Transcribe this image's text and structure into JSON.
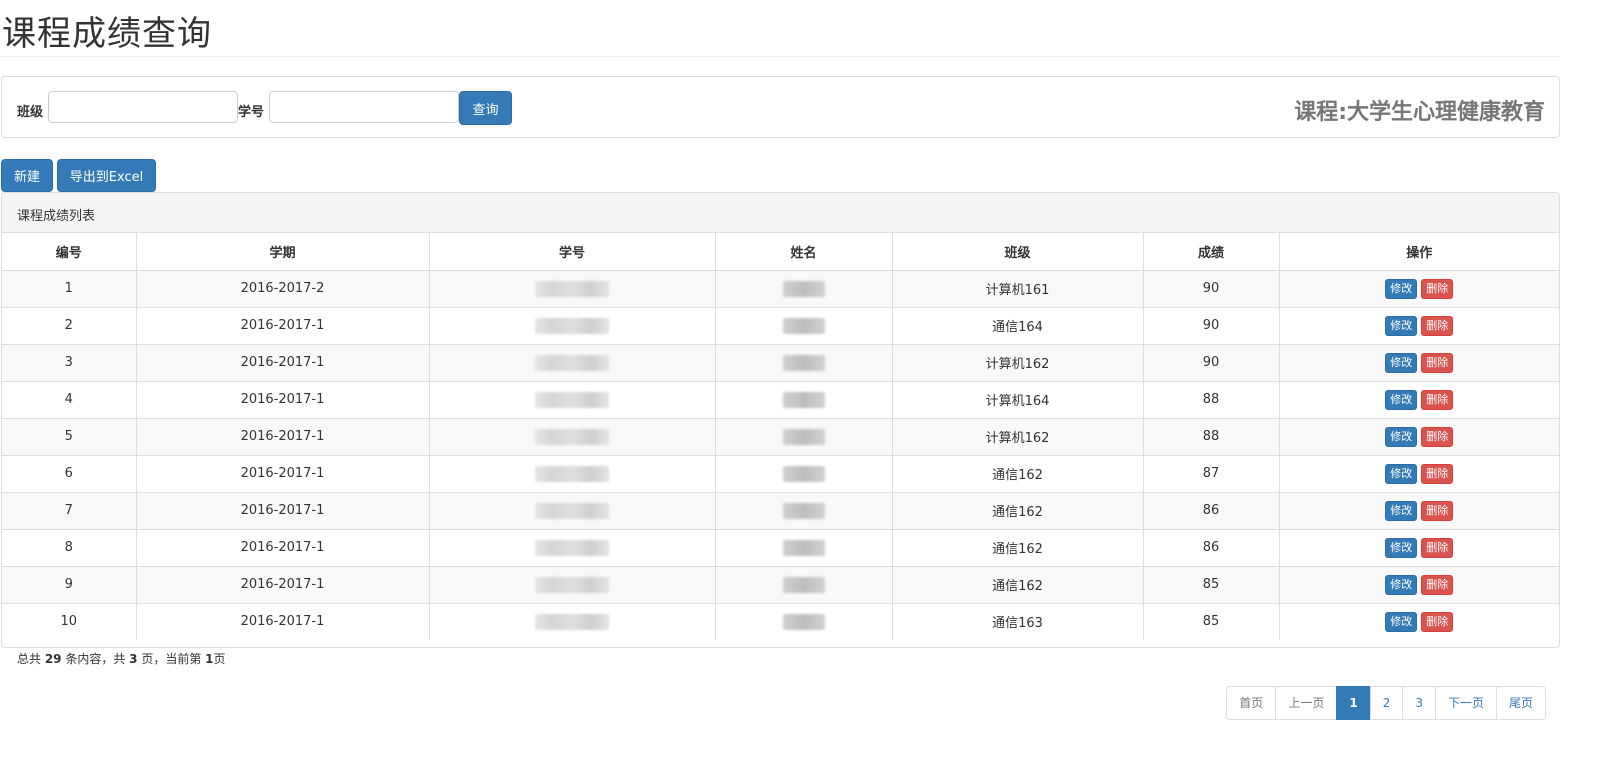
{
  "page": {
    "title": "课程成绩查询"
  },
  "search": {
    "class_label": "班级",
    "class_value": "",
    "student_id_label": "学号",
    "student_id_value": "",
    "submit_label": "查询",
    "course_label": "课程:大学生心理健康教育"
  },
  "toolbar": {
    "new_label": "新建",
    "export_label": "导出到Excel"
  },
  "list": {
    "heading": "课程成绩列表",
    "columns": [
      "编号",
      "学期",
      "学号",
      "姓名",
      "班级",
      "成绩",
      "操作"
    ],
    "edit_label": "修改",
    "delete_label": "删除",
    "rows": [
      {
        "no": "1",
        "term": "2016-2017-2",
        "class": "计算机161",
        "score": "90"
      },
      {
        "no": "2",
        "term": "2016-2017-1",
        "class": "通信164",
        "score": "90"
      },
      {
        "no": "3",
        "term": "2016-2017-1",
        "class": "计算机162",
        "score": "90"
      },
      {
        "no": "4",
        "term": "2016-2017-1",
        "class": "计算机164",
        "score": "88"
      },
      {
        "no": "5",
        "term": "2016-2017-1",
        "class": "计算机162",
        "score": "88"
      },
      {
        "no": "6",
        "term": "2016-2017-1",
        "class": "通信162",
        "score": "87"
      },
      {
        "no": "7",
        "term": "2016-2017-1",
        "class": "通信162",
        "score": "86"
      },
      {
        "no": "8",
        "term": "2016-2017-1",
        "class": "通信162",
        "score": "86"
      },
      {
        "no": "9",
        "term": "2016-2017-1",
        "class": "通信162",
        "score": "85"
      },
      {
        "no": "10",
        "term": "2016-2017-1",
        "class": "通信163",
        "score": "85"
      }
    ]
  },
  "summary": {
    "prefix": "总共 ",
    "total": "29",
    "mid1": " 条内容，共 ",
    "pages": "3",
    "mid2": " 页，当前第 ",
    "current": "1",
    "suffix": "页"
  },
  "pagination": {
    "first": "首页",
    "prev": "上一页",
    "pages": [
      "1",
      "2",
      "3"
    ],
    "next": "下一页",
    "last": "尾页"
  },
  "colors": {
    "primary": "#337ab7",
    "danger": "#d9534f"
  }
}
